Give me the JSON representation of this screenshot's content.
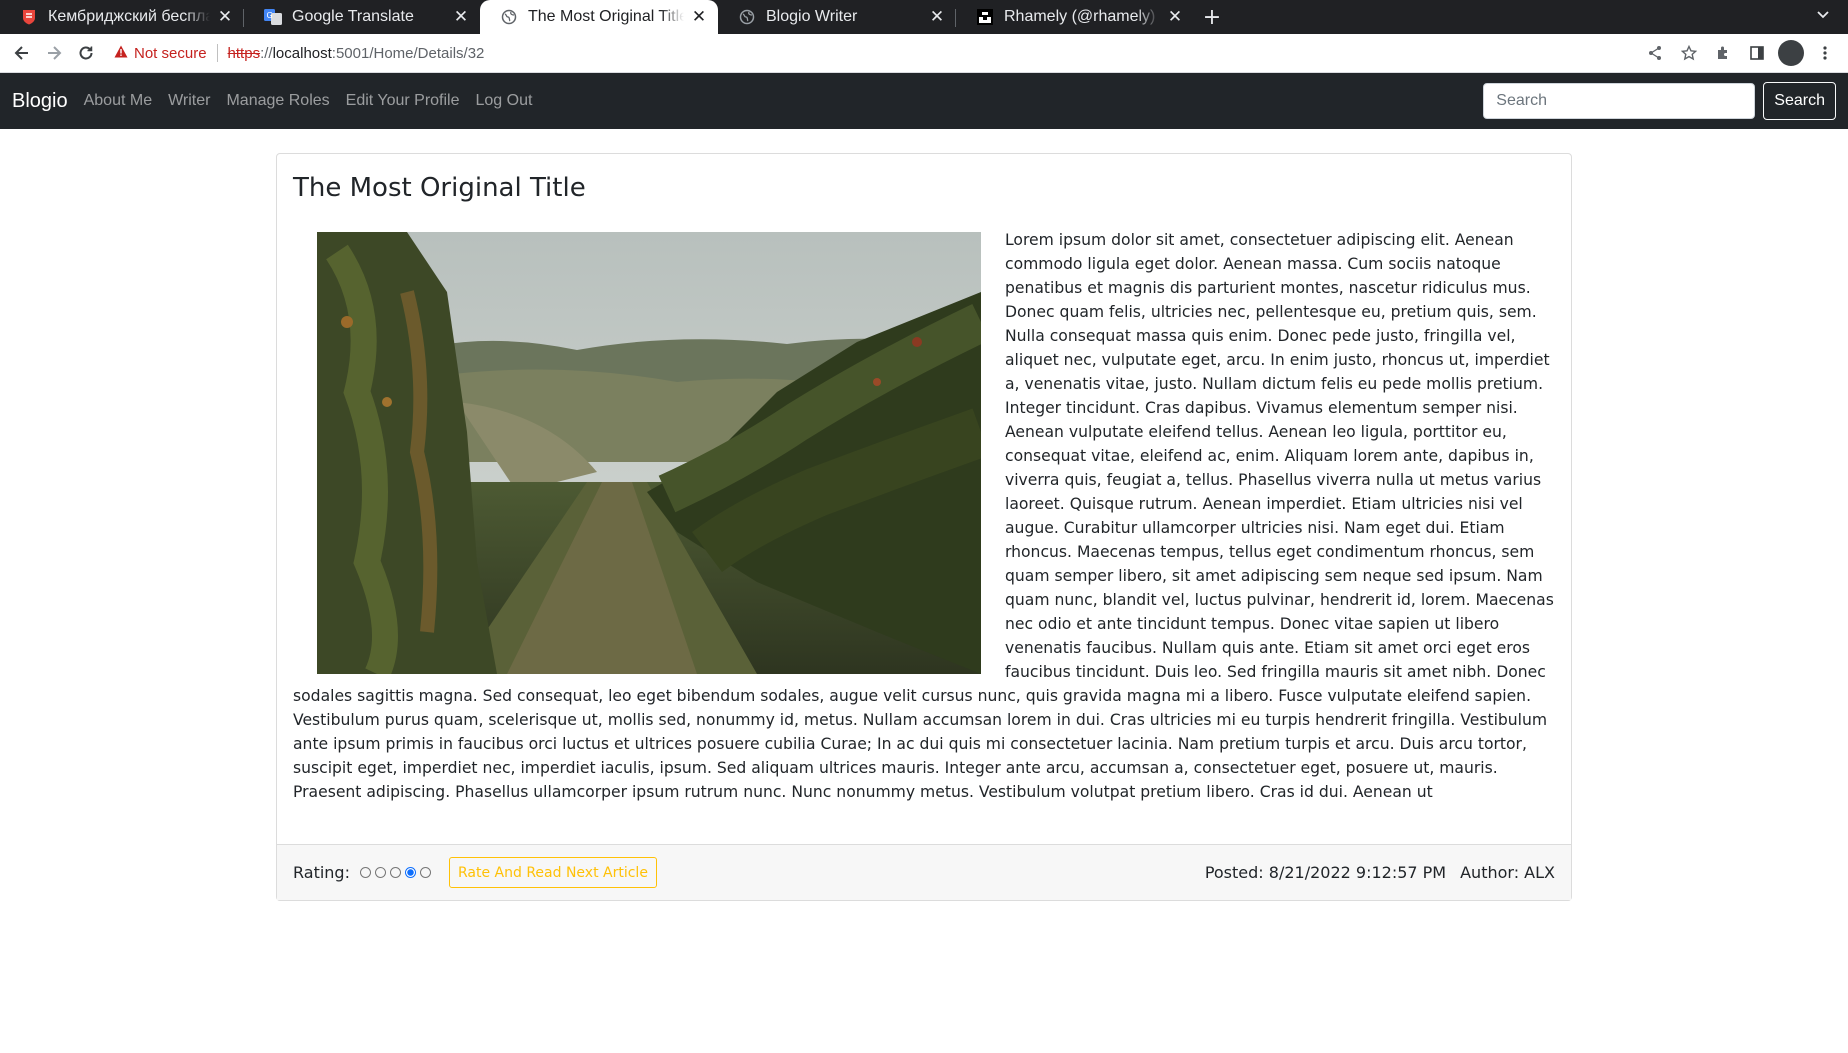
{
  "browser": {
    "tabs": [
      {
        "title": "Кембриджский бесплатный",
        "favicon": "cambridge-icon",
        "active": false
      },
      {
        "title": "Google Translate",
        "favicon": "google-translate-icon",
        "active": false
      },
      {
        "title": "The Most Original Title Details",
        "favicon": "globe-icon",
        "active": true
      },
      {
        "title": "Blogio Writer",
        "favicon": "globe-icon",
        "active": false
      },
      {
        "title": "Rhamely (@rhamely) | Unsplash",
        "favicon": "unsplash-icon",
        "active": false
      }
    ],
    "security_label": "Not secure",
    "url": {
      "scheme": "https",
      "sep": "://",
      "host": "localhost",
      "rest": ":5001/Home/Details/32"
    }
  },
  "navbar": {
    "brand": "Blogio",
    "links": [
      "About Me",
      "Writer",
      "Manage Roles",
      "Edit Your Profile",
      "Log Out"
    ],
    "search_placeholder": "Search",
    "search_button": "Search"
  },
  "article": {
    "title": "The Most Original Title",
    "image_alt": "vineyard-photo",
    "body": "Lorem ipsum dolor sit amet, consectetuer adipiscing elit. Aenean commodo ligula eget dolor. Aenean massa. Cum sociis natoque penatibus et magnis dis parturient montes, nascetur ridiculus mus. Donec quam felis, ultricies nec, pellentesque eu, pretium quis, sem. Nulla consequat massa quis enim. Donec pede justo, fringilla vel, aliquet nec, vulputate eget, arcu. In enim justo, rhoncus ut, imperdiet a, venenatis vitae, justo. Nullam dictum felis eu pede mollis pretium. Integer tincidunt. Cras dapibus. Vivamus elementum semper nisi. Aenean vulputate eleifend tellus. Aenean leo ligula, porttitor eu, consequat vitae, eleifend ac, enim. Aliquam lorem ante, dapibus in, viverra quis, feugiat a, tellus. Phasellus viverra nulla ut metus varius laoreet. Quisque rutrum. Aenean imperdiet. Etiam ultricies nisi vel augue. Curabitur ullamcorper ultricies nisi. Nam eget dui. Etiam rhoncus. Maecenas tempus, tellus eget condimentum rhoncus, sem quam semper libero, sit amet adipiscing sem neque sed ipsum. Nam quam nunc, blandit vel, luctus pulvinar, hendrerit id, lorem. Maecenas nec odio et ante tincidunt tempus. Donec vitae sapien ut libero venenatis faucibus. Nullam quis ante. Etiam sit amet orci eget eros faucibus tincidunt. Duis leo. Sed fringilla mauris sit amet nibh. Donec sodales sagittis magna. Sed consequat, leo eget bibendum sodales, augue velit cursus nunc, quis gravida magna mi a libero. Fusce vulputate eleifend sapien. Vestibulum purus quam, scelerisque ut, mollis sed, nonummy id, metus. Nullam accumsan lorem in dui. Cras ultricies mi eu turpis hendrerit fringilla. Vestibulum ante ipsum primis in faucibus orci luctus et ultrices posuere cubilia Curae; In ac dui quis mi consectetuer lacinia. Nam pretium turpis et arcu. Duis arcu tortor, suscipit eget, imperdiet nec, imperdiet iaculis, ipsum. Sed aliquam ultrices mauris. Integer ante arcu, accumsan a, consectetuer eget, posuere ut, mauris. Praesent adipiscing. Phasellus ullamcorper ipsum rutrum nunc. Nunc nonummy metus. Vestibulum volutpat pretium libero. Cras id dui. Aenean ut"
  },
  "footer": {
    "rating_label": "Rating:",
    "rating_options": 5,
    "rating_selected": 4,
    "rate_button": "Rate And Read Next Article",
    "posted": "Posted: 8/21/2022 9:12:57 PM",
    "author": "Author: ALX"
  },
  "colors": {
    "navbar_bg": "#212529",
    "warning": "#ffc107",
    "radio_checked": "#0d6efd",
    "not_secure": "#c5221f"
  }
}
